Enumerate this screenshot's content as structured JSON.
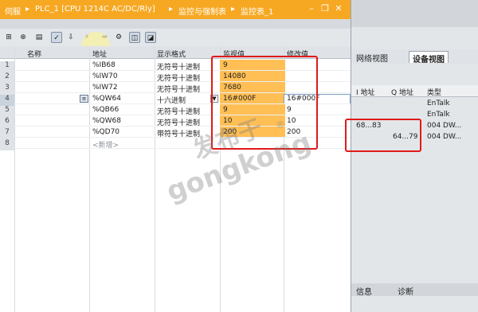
{
  "titlebar": {
    "segments": [
      "伺服",
      "PLC_1 [CPU 1214C AC/DC/Rly]",
      "监控与强制表",
      "监控表_1"
    ],
    "separator": "▸"
  },
  "grid": {
    "headers": [
      "名称",
      "地址",
      "显示格式",
      "监视值",
      "修改值"
    ],
    "rows": [
      {
        "n": "1",
        "addr": "%IB68",
        "fmt": "无符号十进制",
        "mon": "9",
        "mod": ""
      },
      {
        "n": "2",
        "addr": "%IW70",
        "fmt": "无符号十进制",
        "mon": "14080",
        "mod": ""
      },
      {
        "n": "3",
        "addr": "%IW72",
        "fmt": "无符号十进制",
        "mon": "7680",
        "mod": ""
      },
      {
        "n": "4",
        "addr": "%QW64",
        "fmt": "十六进制",
        "mon": "16#000F",
        "mod": "16#000F"
      },
      {
        "n": "5",
        "addr": "%QB66",
        "fmt": "无符号十进制",
        "mon": "9",
        "mod": "9"
      },
      {
        "n": "6",
        "addr": "%QW68",
        "fmt": "无符号十进制",
        "mon": "10",
        "mod": "10"
      },
      {
        "n": "7",
        "addr": "%QD70",
        "fmt": "带符号十进制",
        "mon": "200",
        "mod": "200"
      },
      {
        "n": "8",
        "addr": "<新增>",
        "fmt": "",
        "mon": "",
        "mod": ""
      }
    ]
  },
  "right": {
    "tabs": [
      "网络视图",
      "设备视图"
    ],
    "columns": [
      "I 地址",
      "Q 地址",
      "类型"
    ],
    "rows": [
      {
        "i": "",
        "q": "",
        "type": "EnTalk"
      },
      {
        "i": "",
        "q": "",
        "type": "EnTalk"
      },
      {
        "i": "68...83",
        "q": "",
        "type": "004 DW..."
      },
      {
        "i": "",
        "q": "64...79",
        "type": "004 DW..."
      }
    ],
    "bottom": [
      "信息",
      "诊断"
    ]
  },
  "watermark": {
    "line1": "发布于",
    "line2": "gongkong",
    "mark": "®"
  }
}
